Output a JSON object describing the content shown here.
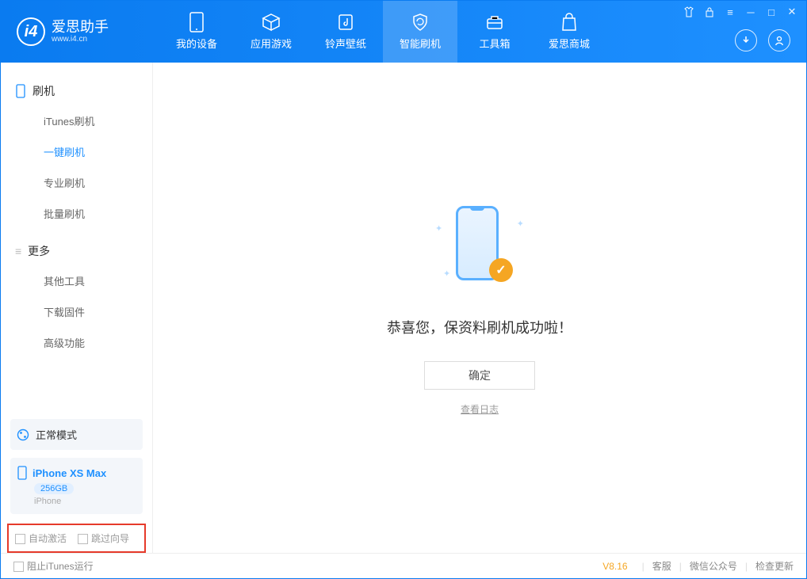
{
  "app": {
    "name": "爱思助手",
    "domain": "www.i4.cn"
  },
  "header_tabs": [
    {
      "label": "我的设备"
    },
    {
      "label": "应用游戏"
    },
    {
      "label": "铃声壁纸"
    },
    {
      "label": "智能刷机"
    },
    {
      "label": "工具箱"
    },
    {
      "label": "爱思商城"
    }
  ],
  "sidebar": {
    "section1_title": "刷机",
    "section1_items": [
      "iTunes刷机",
      "一键刷机",
      "专业刷机",
      "批量刷机"
    ],
    "section2_title": "更多",
    "section2_items": [
      "其他工具",
      "下载固件",
      "高级功能"
    ],
    "status_mode": "正常模式",
    "device": {
      "name": "iPhone XS Max",
      "capacity": "256GB",
      "type": "iPhone"
    },
    "check_auto_activate": "自动激活",
    "check_skip_wizard": "跳过向导"
  },
  "main": {
    "success_message": "恭喜您，保资料刷机成功啦！",
    "ok_button": "确定",
    "view_log": "查看日志"
  },
  "footer": {
    "block_itunes": "阻止iTunes运行",
    "version": "V8.16",
    "links": [
      "客服",
      "微信公众号",
      "检查更新"
    ]
  }
}
